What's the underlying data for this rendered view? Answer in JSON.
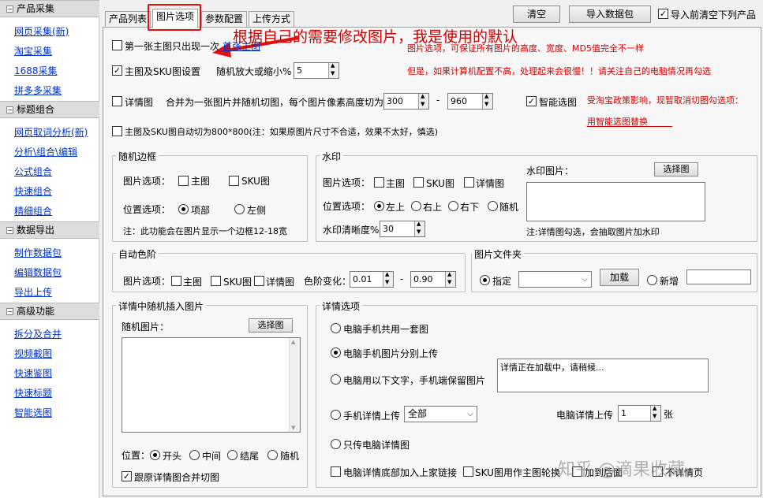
{
  "sidebar": {
    "sections": [
      {
        "title": "产品采集",
        "items": [
          "网页采集(新)",
          "淘宝采集",
          "1688采集",
          "拼多多采集"
        ]
      },
      {
        "title": "标题组合",
        "items": [
          "网页取词分析(新)",
          "分析\\组合\\编辑",
          "公式组合",
          "快速组合",
          "精细组合"
        ]
      },
      {
        "title": "数据导出",
        "items": [
          "制作数据包",
          "编辑数据包",
          "导出上传"
        ]
      },
      {
        "title": "高级功能",
        "items": [
          "拆分及合并",
          "视频截图",
          "快速鉴图",
          "快速标题",
          "智能选图"
        ]
      }
    ],
    "expand_symbol": "−"
  },
  "tabs": [
    "产品列表",
    "图片选项",
    "参数配置",
    "上传方式"
  ],
  "toolbar": {
    "clear": "清空",
    "import": "导入数据包",
    "import_clear": "导入前清空下列产品"
  },
  "annotation": "根据自己的需要修改图片，我是使用的默认",
  "notes": {
    "line1": "图片选项，可保证所有图片的高度、宽度、MD5值完全不一样",
    "line2": "但是，如果计算机配置不高，处理起来会很慢！！请关注自己的电脑情况再勾选",
    "policy1": "受淘宝政策影响，现暂取消切图勾选项：",
    "policy2": "用智能选图替换"
  },
  "options": {
    "first_main": "第一张主图只出现一次",
    "first_main_link": "首张主图",
    "main_sku": "主图及SKU图设置",
    "scale_label": "随机放大或缩小%",
    "scale_value": "5",
    "detail": "详情图",
    "merge_label": "合并为一张图片并随机切图，每个图片像素高度切为",
    "h_min": "300",
    "dash": "-",
    "h_max": "960",
    "smart": "智能选图",
    "auto_cut": "主图及SKU图自动切为800*800(注：如果原图片尺寸不合适，效果不太好，慎选)"
  },
  "border_group": {
    "title": "随机边框",
    "pic_label": "图片选项：",
    "main": "主图",
    "sku": "SKU图",
    "pos_label": "位置选项：",
    "top": "项部",
    "left": "左侧",
    "note": "注：此功能会在图片显示一个边框12-18宽"
  },
  "watermark": {
    "title": "水印",
    "pic_label": "图片选项：",
    "main": "主图",
    "sku": "SKU图",
    "detail": "详情图",
    "pos_label": "位置选项：",
    "tl": "左上",
    "tr": "右上",
    "br": "右下",
    "rand": "随机",
    "clarity_label": "水印清晰度%",
    "clarity": "30",
    "img_label": "水印图片：",
    "choose": "选择图",
    "note": "注:详情图勾选，会抽取图片加水印"
  },
  "levels": {
    "title": "自动色阶",
    "pic_label": "图片选项：",
    "main": "主图",
    "sku": "SKU图",
    "detail": "详情图",
    "change": "色阶变化：",
    "min": "0.01",
    "dash": "-",
    "max": "0.90"
  },
  "folder": {
    "title": "图片文件夹",
    "specify": "指定",
    "load": "加载",
    "add": "新增"
  },
  "insert": {
    "title": "详情中随机插入图片",
    "rand_label": "随机图片：",
    "choose": "选择图",
    "pos_label": "位置：",
    "start": "开头",
    "middle": "中间",
    "end": "结尾",
    "rand": "随机",
    "merge": "跟原详情图合并切图"
  },
  "detail_opts": {
    "title": "详情选项",
    "o1": "电脑手机共用一套图",
    "o2": "电脑手机图片分别上传",
    "o3": "电脑用以下文字，手机端保留图片",
    "loading": "详情正在加载中，请稍候...",
    "o4": "手机详情上传",
    "all": "全部",
    "pc_upload": "电脑详情上传",
    "count": "1",
    "unit": "张",
    "o5": "只传电脑详情图",
    "c1": "电脑详情底部加入上家链接",
    "c2": "SKU图用作主图轮换",
    "c3": "加到后面",
    "c4": "不详情页"
  },
  "watermark_site": "知乎 @滴果收藏"
}
